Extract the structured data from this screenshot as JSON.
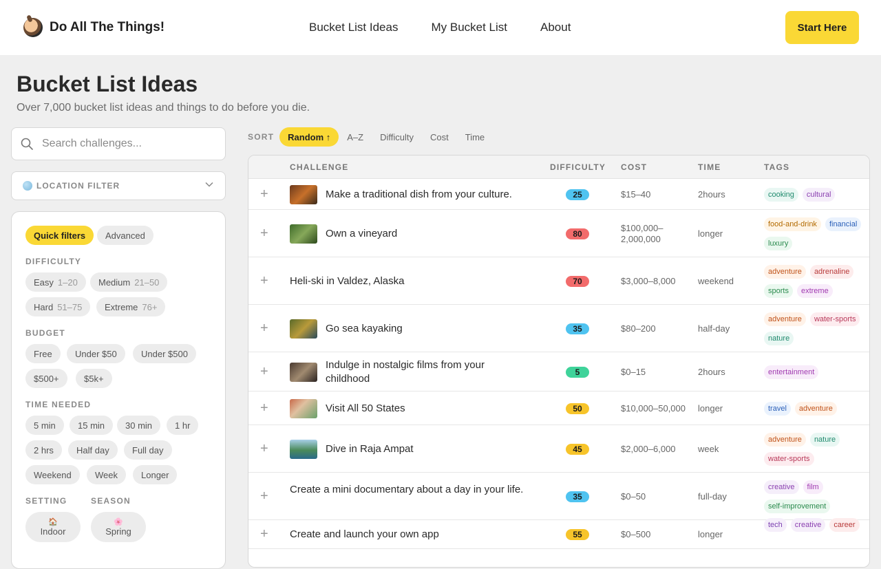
{
  "header": {
    "brand": "Do All The Things!",
    "nav": [
      "Bucket List Ideas",
      "My Bucket List",
      "About"
    ],
    "cta": "Start Here"
  },
  "page": {
    "title": "Bucket List Ideas",
    "subtitle": "Over 7,000 bucket list ideas and things to do before you die."
  },
  "sidebar": {
    "search_placeholder": "Search challenges...",
    "location_filter": "LOCATION FILTER",
    "tabs": {
      "quick": "Quick filters",
      "advanced": "Advanced"
    },
    "difficulty": {
      "label": "DIFFICULTY",
      "options": [
        {
          "name": "Easy",
          "range": "1–20"
        },
        {
          "name": "Medium",
          "range": "21–50"
        },
        {
          "name": "Hard",
          "range": "51–75"
        },
        {
          "name": "Extreme",
          "range": "76+"
        }
      ]
    },
    "budget": {
      "label": "BUDGET",
      "options": [
        "Free",
        "Under $50",
        "Under $500",
        "$500+",
        "$5k+"
      ]
    },
    "time": {
      "label": "TIME NEEDED",
      "options": [
        "5 min",
        "15 min",
        "30 min",
        "1 hr",
        "2 hrs",
        "Half day",
        "Full day",
        "Weekend",
        "Week",
        "Longer"
      ]
    },
    "setting": {
      "label": "SETTING",
      "options": [
        {
          "icon": "house-icon",
          "emoji": "🏠",
          "label": "Indoor"
        }
      ]
    },
    "season": {
      "label": "SEASON",
      "options": [
        {
          "icon": "blossom-icon",
          "emoji": "🌸",
          "label": "Spring"
        }
      ]
    }
  },
  "sort": {
    "label": "SORT",
    "options": [
      "Random ↑",
      "A–Z",
      "Difficulty",
      "Cost",
      "Time"
    ],
    "active": "Random ↑"
  },
  "table": {
    "columns": [
      "CHALLENGE",
      "DIFFICULTY",
      "COST",
      "TIME",
      "TAGS"
    ],
    "rows": [
      {
        "title": "Make a traditional dish from your culture.",
        "difficulty": "25",
        "cost": "$15–40",
        "time": "2hours",
        "tags": [
          "cooking",
          "cultural"
        ]
      },
      {
        "title": "Own a vineyard",
        "difficulty": "80",
        "cost": "$100,000–2,000,000",
        "time": "longer",
        "tags": [
          "food-and-drink",
          "financial",
          "luxury"
        ]
      },
      {
        "title": "Heli-ski in Valdez, Alaska",
        "difficulty": "70",
        "cost": "$3,000–8,000",
        "time": "weekend",
        "tags": [
          "adventure",
          "adrenaline",
          "sports",
          "extreme"
        ]
      },
      {
        "title": "Go sea kayaking",
        "difficulty": "35",
        "cost": "$80–200",
        "time": "half-day",
        "tags": [
          "adventure",
          "water-sports",
          "nature"
        ]
      },
      {
        "title": "Indulge in nostalgic films from your childhood",
        "difficulty": "5",
        "cost": "$0–15",
        "time": "2hours",
        "tags": [
          "entertainment"
        ]
      },
      {
        "title": "Visit All 50 States",
        "difficulty": "50",
        "cost": "$10,000–50,000",
        "time": "longer",
        "tags": [
          "travel",
          "adventure"
        ]
      },
      {
        "title": "Dive in Raja Ampat",
        "difficulty": "45",
        "cost": "$2,000–6,000",
        "time": "week",
        "tags": [
          "adventure",
          "nature",
          "water-sports"
        ]
      },
      {
        "title": "Create a mini documentary about a day in your life.",
        "difficulty": "35",
        "cost": "$0–50",
        "time": "full-day",
        "tags": [
          "creative",
          "film",
          "self-improvement"
        ]
      },
      {
        "title": "Create and launch your own app",
        "difficulty": "55",
        "cost": "$0–500",
        "time": "longer",
        "tags": [
          "tech",
          "creative",
          "career"
        ]
      }
    ]
  },
  "colors": {
    "accent": "#fad835",
    "difficulty_blue": "#4fc3f0",
    "difficulty_red": "#f26b6b",
    "difficulty_green": "#3fd39a",
    "difficulty_yellow": "#f7c42a"
  }
}
